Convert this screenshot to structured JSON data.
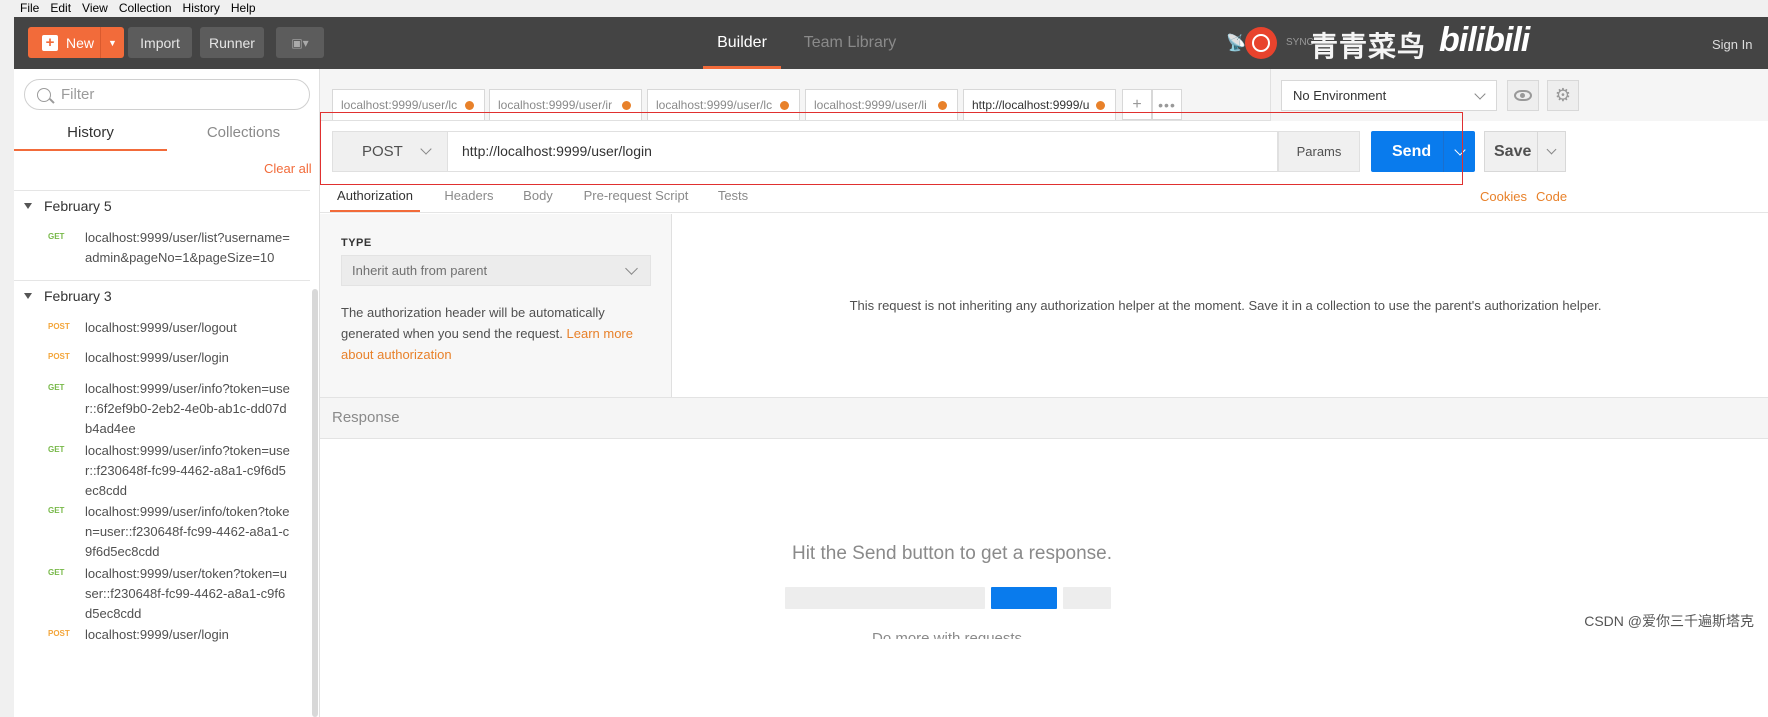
{
  "menu": [
    "File",
    "Edit",
    "View",
    "Collection",
    "History",
    "Help"
  ],
  "header": {
    "new_label": "New",
    "import_label": "Import",
    "runner_label": "Runner",
    "nav_builder": "Builder",
    "nav_team": "Team Library",
    "sync_text": "SYNC",
    "watermark_text": "青青菜鸟",
    "bili_text": "bilibili",
    "signin_text": "Sign In"
  },
  "sidebar": {
    "filter_placeholder": "Filter",
    "tab_history": "History",
    "tab_collections": "Collections",
    "clear_all": "Clear all",
    "groups": [
      {
        "date": "February 5",
        "items": [
          {
            "method": "GET",
            "url": "localhost:9999/user/list?username=admin&pageNo=1&pageSize=10"
          }
        ]
      },
      {
        "date": "February 3",
        "items": [
          {
            "method": "POST",
            "url": "localhost:9999/user/logout"
          },
          {
            "method": "POST",
            "url": "localhost:9999/user/login"
          },
          {
            "method": "GET",
            "url": "localhost:9999/user/info?token=user::6f2ef9b0-2eb2-4e0b-ab1c-dd07db4ad4ee"
          },
          {
            "method": "GET",
            "url": "localhost:9999/user/info?token=user::f230648f-fc99-4462-a8a1-c9f6d5ec8cdd"
          },
          {
            "method": "GET",
            "url": "localhost:9999/user/info/token?token=user::f230648f-fc99-4462-a8a1-c9f6d5ec8cdd"
          },
          {
            "method": "GET",
            "url": "localhost:9999/user/token?token=user::f230648f-fc99-4462-a8a1-c9f6d5ec8cdd"
          },
          {
            "method": "POST",
            "url": "localhost:9999/user/login"
          }
        ]
      }
    ]
  },
  "request_tabs": [
    {
      "label": "localhost:9999/user/lc"
    },
    {
      "label": "localhost:9999/user/ir"
    },
    {
      "label": "localhost:9999/user/lc"
    },
    {
      "label": "localhost:9999/user/li"
    },
    {
      "label": "http://localhost:9999/u"
    }
  ],
  "tab_more": "•••",
  "environment": {
    "selected": "No Environment"
  },
  "request": {
    "method": "POST",
    "url": "http://localhost:9999/user/login",
    "params_label": "Params",
    "send_label": "Send",
    "save_label": "Save"
  },
  "subtabs": [
    "Authorization",
    "Headers",
    "Body",
    "Pre-request Script",
    "Tests"
  ],
  "subtab_links": {
    "cookies": "Cookies",
    "code": "Code"
  },
  "auth": {
    "type_label": "TYPE",
    "type_value": "Inherit auth from parent",
    "help_text": "The authorization header will be automatically generated when you send the request. ",
    "help_link": "Learn more about authorization",
    "info_text": "This request is not inheriting any authorization helper at the moment. Save it in a collection to use the parent's authorization helper."
  },
  "response": {
    "title": "Response",
    "hint": "Hit the Send button to get a response.",
    "cut_text": "Do more with requests"
  },
  "watermark_csdn": "CSDN @爱你三千遍斯塔克",
  "colors": {
    "accent": "#f26b3a",
    "send_blue": "#097bed",
    "header_bg": "#444444",
    "highlight_red": "#e0302f"
  }
}
